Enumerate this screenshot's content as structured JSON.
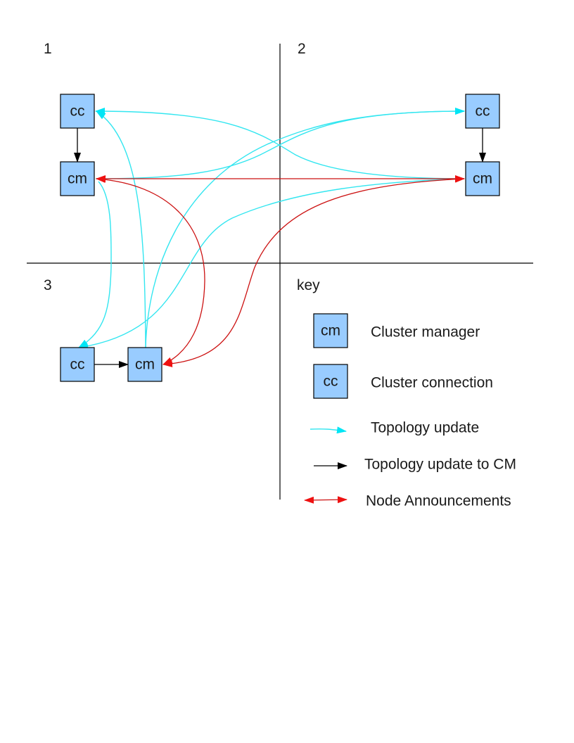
{
  "colors": {
    "node_fill": "#99ccff",
    "topology_update": "#33e6f0",
    "topology_update_to_cm": "#000000",
    "node_announcements": "#ee1111"
  },
  "quadrants": [
    {
      "id": "1",
      "label": "1"
    },
    {
      "id": "2",
      "label": "2"
    },
    {
      "id": "3",
      "label": "3"
    },
    {
      "id": "key",
      "label": "key"
    }
  ],
  "nodes": {
    "q1_cc": {
      "label": "cc"
    },
    "q1_cm": {
      "label": "cm"
    },
    "q2_cc": {
      "label": "cc"
    },
    "q2_cm": {
      "label": "cm"
    },
    "q3_cc": {
      "label": "cc"
    },
    "q3_cm": {
      "label": "cm"
    }
  },
  "edges": [
    {
      "from": "q1_cc",
      "to": "q1_cm",
      "type": "topology_update_to_cm"
    },
    {
      "from": "q2_cc",
      "to": "q2_cm",
      "type": "topology_update_to_cm"
    },
    {
      "from": "q3_cc",
      "to": "q3_cm",
      "type": "topology_update_to_cm"
    },
    {
      "from": "q2_cm",
      "to": "q1_cc",
      "type": "topology_update"
    },
    {
      "from": "q1_cm",
      "to": "q2_cc",
      "type": "topology_update"
    },
    {
      "from": "q3_cm",
      "to": "q2_cc",
      "type": "topology_update"
    },
    {
      "from": "q3_cm",
      "to": "q1_cc",
      "type": "topology_update"
    },
    {
      "from": "q1_cm",
      "to": "q3_cc",
      "type": "topology_update"
    },
    {
      "from": "q2_cm",
      "to": "q3_cc",
      "type": "topology_update"
    },
    {
      "from": "q1_cm",
      "to": "q2_cm",
      "type": "node_announcements"
    },
    {
      "from": "q1_cm",
      "to": "q3_cm",
      "type": "node_announcements"
    },
    {
      "from": "q2_cm",
      "to": "q3_cm",
      "type": "node_announcements"
    }
  ],
  "legend": {
    "title": "key",
    "items": [
      {
        "symbol": "cm",
        "label": "Cluster manager"
      },
      {
        "symbol": "cc",
        "label": "Cluster connection"
      },
      {
        "symbol": "cyan-arrow",
        "label": "Topology update"
      },
      {
        "symbol": "black-arrow",
        "label": "Topology update to CM"
      },
      {
        "symbol": "red-double-arrow",
        "label": "Node Announcements"
      }
    ]
  }
}
